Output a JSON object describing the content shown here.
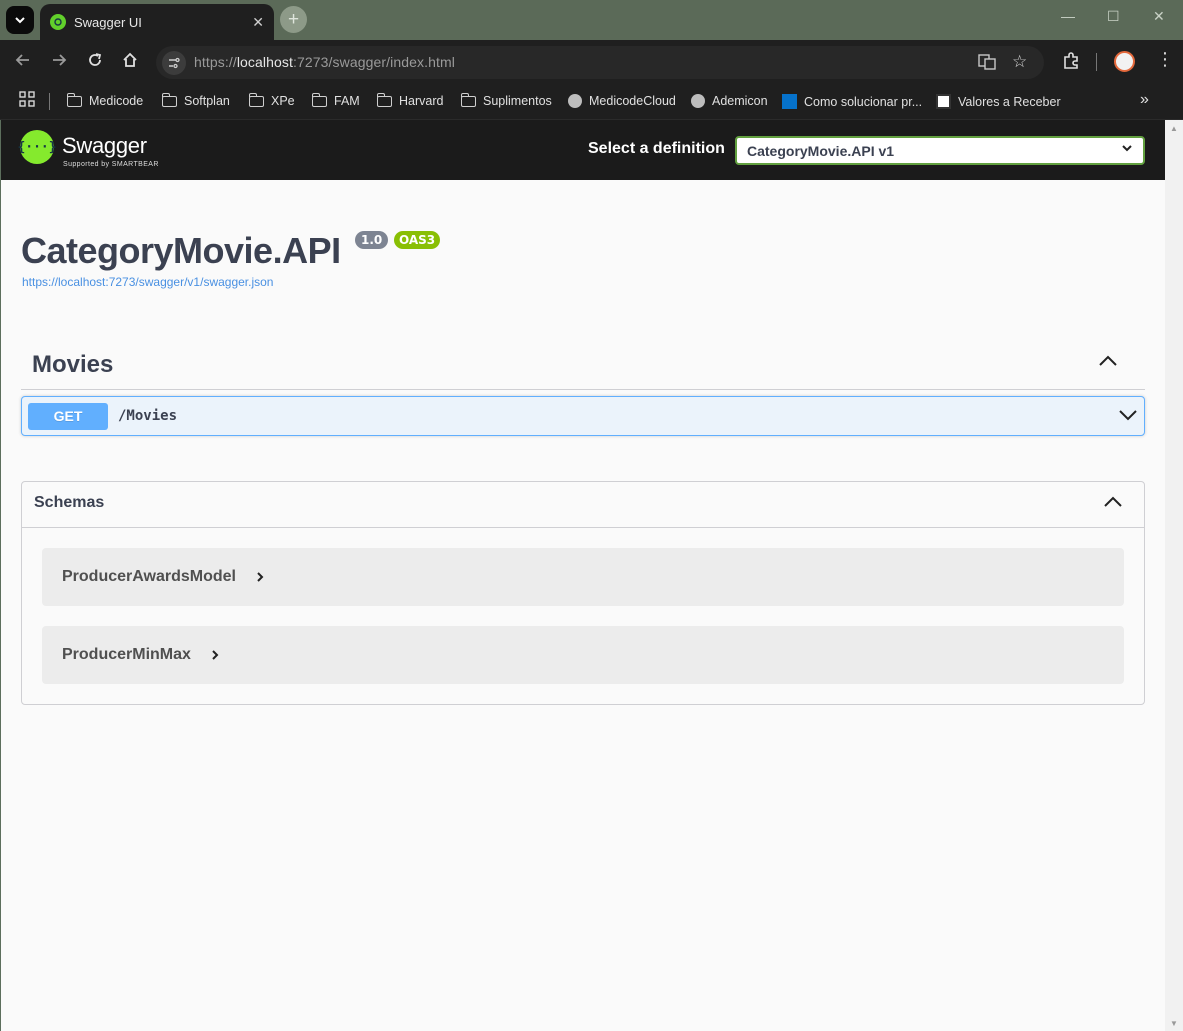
{
  "browser": {
    "tab_title": "Swagger UI",
    "url_prefix": "https://",
    "url_host": "localhost",
    "url_rest": ":7273/swagger/index.html",
    "bookmarks": [
      {
        "label": "Medicode",
        "icon": "folder-icon"
      },
      {
        "label": "Softplan",
        "icon": "folder-icon"
      },
      {
        "label": "XPe",
        "icon": "folder-icon"
      },
      {
        "label": "FAM",
        "icon": "folder-icon"
      },
      {
        "label": "Harvard",
        "icon": "folder-icon"
      },
      {
        "label": "Suplimentos",
        "icon": "folder-icon"
      },
      {
        "label": "MedicodeCloud",
        "icon": "globe-icon"
      },
      {
        "label": "Ademicon",
        "icon": "globe-icon"
      },
      {
        "label": "Como solucionar pr...",
        "icon": "dell-icon"
      },
      {
        "label": "Valores a Receber",
        "icon": "site-icon"
      }
    ],
    "more_bookmarks": "»"
  },
  "swagger": {
    "brand": "Swagger",
    "brand_sub": "Supported by SMARTBEAR",
    "select_label": "Select a definition",
    "selected_definition": "CategoryMovie.API v1",
    "api_title": "CategoryMovie.API",
    "version_badge": "1.0",
    "oas_badge": "OAS3",
    "spec_url": "https://localhost:7273/swagger/v1/swagger.json",
    "tag": "Movies",
    "operations": [
      {
        "method": "GET",
        "path": "/Movies"
      }
    ],
    "schemas_title": "Schemas",
    "models": [
      "ProducerAwardsModel",
      "ProducerMinMax"
    ]
  },
  "colors": {
    "get_method": "#61affe",
    "oas_badge": "#89bf04",
    "version_badge": "#7d8492",
    "swagger_logo": "#85ea2d",
    "topbar": "#1b1b1b"
  }
}
